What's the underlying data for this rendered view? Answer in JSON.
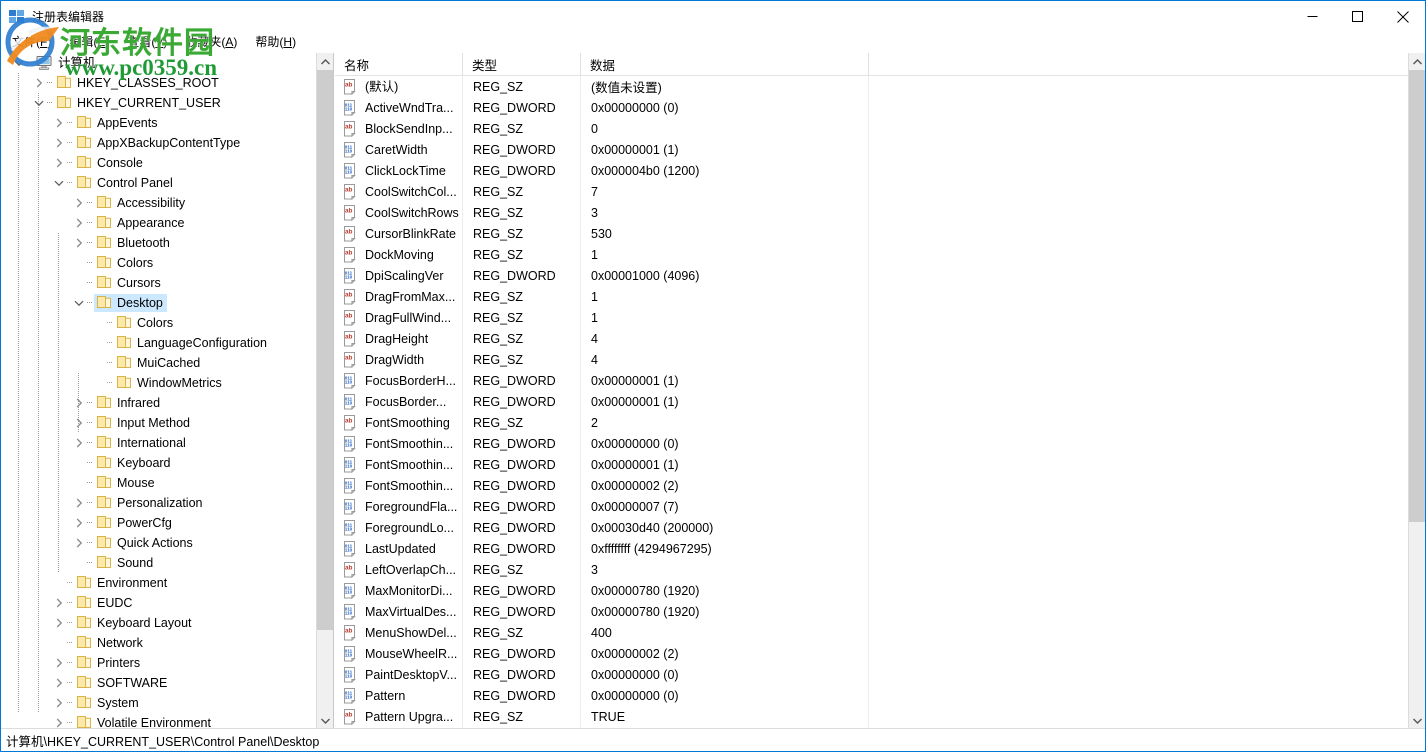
{
  "window": {
    "title": "注册表编辑器",
    "icon": "registry-editor-icon",
    "accent_color": "#0078d7",
    "buttons": {
      "minimize": "最小化",
      "maximize": "最大化",
      "close": "关闭"
    }
  },
  "menubar": [
    {
      "name": "file",
      "label": "文件(F)",
      "text": "文件(",
      "accel": "F",
      "tail": ")"
    },
    {
      "name": "edit",
      "label": "编辑(E)",
      "text": "编辑(",
      "accel": "E",
      "tail": ")"
    },
    {
      "name": "view",
      "label": "查看(V)",
      "text": "查看(",
      "accel": "V",
      "tail": ")"
    },
    {
      "name": "favorites",
      "label": "收藏夹(A)",
      "text": "收藏夹(",
      "accel": "A",
      "tail": ")"
    },
    {
      "name": "help",
      "label": "帮助(H)",
      "text": "帮助(",
      "accel": "H",
      "tail": ")"
    }
  ],
  "tree": {
    "selected": "Desktop",
    "items": [
      {
        "label": "计算机",
        "depth": 0,
        "icon": "computer-icon",
        "twist": "expanded"
      },
      {
        "label": "HKEY_CLASSES_ROOT",
        "depth": 1,
        "icon": "folder-icon",
        "twist": "collapsed"
      },
      {
        "label": "HKEY_CURRENT_USER",
        "depth": 1,
        "icon": "folder-icon",
        "twist": "expanded"
      },
      {
        "label": "AppEvents",
        "depth": 2,
        "icon": "folder-icon",
        "twist": "collapsed"
      },
      {
        "label": "AppXBackupContentType",
        "depth": 2,
        "icon": "folder-icon",
        "twist": "collapsed"
      },
      {
        "label": "Console",
        "depth": 2,
        "icon": "folder-icon",
        "twist": "collapsed"
      },
      {
        "label": "Control Panel",
        "depth": 2,
        "icon": "folder-icon",
        "twist": "expanded"
      },
      {
        "label": "Accessibility",
        "depth": 3,
        "icon": "folder-icon",
        "twist": "collapsed"
      },
      {
        "label": "Appearance",
        "depth": 3,
        "icon": "folder-icon",
        "twist": "collapsed"
      },
      {
        "label": "Bluetooth",
        "depth": 3,
        "icon": "folder-icon",
        "twist": "collapsed"
      },
      {
        "label": "Colors",
        "depth": 3,
        "icon": "folder-icon",
        "twist": "none"
      },
      {
        "label": "Cursors",
        "depth": 3,
        "icon": "folder-icon",
        "twist": "none"
      },
      {
        "label": "Desktop",
        "depth": 3,
        "icon": "folder-icon",
        "twist": "expanded",
        "selected": true
      },
      {
        "label": "Colors",
        "depth": 4,
        "icon": "folder-icon",
        "twist": "none"
      },
      {
        "label": "LanguageConfiguration",
        "depth": 4,
        "icon": "folder-icon",
        "twist": "none"
      },
      {
        "label": "MuiCached",
        "depth": 4,
        "icon": "folder-icon",
        "twist": "none"
      },
      {
        "label": "WindowMetrics",
        "depth": 4,
        "icon": "folder-icon",
        "twist": "none"
      },
      {
        "label": "Infrared",
        "depth": 3,
        "icon": "folder-icon",
        "twist": "collapsed"
      },
      {
        "label": "Input Method",
        "depth": 3,
        "icon": "folder-icon",
        "twist": "collapsed"
      },
      {
        "label": "International",
        "depth": 3,
        "icon": "folder-icon",
        "twist": "collapsed"
      },
      {
        "label": "Keyboard",
        "depth": 3,
        "icon": "folder-icon",
        "twist": "none"
      },
      {
        "label": "Mouse",
        "depth": 3,
        "icon": "folder-icon",
        "twist": "none"
      },
      {
        "label": "Personalization",
        "depth": 3,
        "icon": "folder-icon",
        "twist": "collapsed"
      },
      {
        "label": "PowerCfg",
        "depth": 3,
        "icon": "folder-icon",
        "twist": "collapsed"
      },
      {
        "label": "Quick Actions",
        "depth": 3,
        "icon": "folder-icon",
        "twist": "collapsed"
      },
      {
        "label": "Sound",
        "depth": 3,
        "icon": "folder-icon",
        "twist": "none"
      },
      {
        "label": "Environment",
        "depth": 2,
        "icon": "folder-icon",
        "twist": "none"
      },
      {
        "label": "EUDC",
        "depth": 2,
        "icon": "folder-icon",
        "twist": "collapsed"
      },
      {
        "label": "Keyboard Layout",
        "depth": 2,
        "icon": "folder-icon",
        "twist": "collapsed"
      },
      {
        "label": "Network",
        "depth": 2,
        "icon": "folder-icon",
        "twist": "none"
      },
      {
        "label": "Printers",
        "depth": 2,
        "icon": "folder-icon",
        "twist": "collapsed"
      },
      {
        "label": "SOFTWARE",
        "depth": 2,
        "icon": "folder-icon",
        "twist": "collapsed"
      },
      {
        "label": "System",
        "depth": 2,
        "icon": "folder-icon",
        "twist": "collapsed"
      },
      {
        "label": "Volatile Environment",
        "depth": 2,
        "icon": "folder-icon",
        "twist": "collapsed"
      }
    ]
  },
  "list": {
    "columns": [
      {
        "name": "name",
        "label": "名称"
      },
      {
        "name": "type",
        "label": "类型"
      },
      {
        "name": "data",
        "label": "数据"
      }
    ],
    "rows": [
      {
        "name": "(默认)",
        "type": "REG_SZ",
        "data": "(数值未设置)",
        "icon": "string-value-icon"
      },
      {
        "name": "ActiveWndTra...",
        "type": "REG_DWORD",
        "data": "0x00000000 (0)",
        "icon": "dword-value-icon"
      },
      {
        "name": "BlockSendInp...",
        "type": "REG_SZ",
        "data": "0",
        "icon": "string-value-icon"
      },
      {
        "name": "CaretWidth",
        "type": "REG_DWORD",
        "data": "0x00000001 (1)",
        "icon": "dword-value-icon"
      },
      {
        "name": "ClickLockTime",
        "type": "REG_DWORD",
        "data": "0x000004b0 (1200)",
        "icon": "dword-value-icon"
      },
      {
        "name": "CoolSwitchCol...",
        "type": "REG_SZ",
        "data": "7",
        "icon": "string-value-icon"
      },
      {
        "name": "CoolSwitchRows",
        "type": "REG_SZ",
        "data": "3",
        "icon": "string-value-icon"
      },
      {
        "name": "CursorBlinkRate",
        "type": "REG_SZ",
        "data": "530",
        "icon": "string-value-icon"
      },
      {
        "name": "DockMoving",
        "type": "REG_SZ",
        "data": "1",
        "icon": "string-value-icon"
      },
      {
        "name": "DpiScalingVer",
        "type": "REG_DWORD",
        "data": "0x00001000 (4096)",
        "icon": "dword-value-icon"
      },
      {
        "name": "DragFromMax...",
        "type": "REG_SZ",
        "data": "1",
        "icon": "string-value-icon"
      },
      {
        "name": "DragFullWind...",
        "type": "REG_SZ",
        "data": "1",
        "icon": "string-value-icon"
      },
      {
        "name": "DragHeight",
        "type": "REG_SZ",
        "data": "4",
        "icon": "string-value-icon"
      },
      {
        "name": "DragWidth",
        "type": "REG_SZ",
        "data": "4",
        "icon": "string-value-icon"
      },
      {
        "name": "FocusBorderH...",
        "type": "REG_DWORD",
        "data": "0x00000001 (1)",
        "icon": "dword-value-icon"
      },
      {
        "name": "FocusBorder...",
        "type": "REG_DWORD",
        "data": "0x00000001 (1)",
        "icon": "dword-value-icon"
      },
      {
        "name": "FontSmoothing",
        "type": "REG_SZ",
        "data": "2",
        "icon": "string-value-icon"
      },
      {
        "name": "FontSmoothin...",
        "type": "REG_DWORD",
        "data": "0x00000000 (0)",
        "icon": "dword-value-icon"
      },
      {
        "name": "FontSmoothin...",
        "type": "REG_DWORD",
        "data": "0x00000001 (1)",
        "icon": "dword-value-icon"
      },
      {
        "name": "FontSmoothin...",
        "type": "REG_DWORD",
        "data": "0x00000002 (2)",
        "icon": "dword-value-icon"
      },
      {
        "name": "ForegroundFla...",
        "type": "REG_DWORD",
        "data": "0x00000007 (7)",
        "icon": "dword-value-icon"
      },
      {
        "name": "ForegroundLo...",
        "type": "REG_DWORD",
        "data": "0x00030d40 (200000)",
        "icon": "dword-value-icon"
      },
      {
        "name": "LastUpdated",
        "type": "REG_DWORD",
        "data": "0xffffffff (4294967295)",
        "icon": "dword-value-icon"
      },
      {
        "name": "LeftOverlapCh...",
        "type": "REG_SZ",
        "data": "3",
        "icon": "string-value-icon"
      },
      {
        "name": "MaxMonitorDi...",
        "type": "REG_DWORD",
        "data": "0x00000780 (1920)",
        "icon": "dword-value-icon"
      },
      {
        "name": "MaxVirtualDes...",
        "type": "REG_DWORD",
        "data": "0x00000780 (1920)",
        "icon": "dword-value-icon"
      },
      {
        "name": "MenuShowDel...",
        "type": "REG_SZ",
        "data": "400",
        "icon": "string-value-icon"
      },
      {
        "name": "MouseWheelR...",
        "type": "REG_DWORD",
        "data": "0x00000002 (2)",
        "icon": "dword-value-icon"
      },
      {
        "name": "PaintDesktopV...",
        "type": "REG_DWORD",
        "data": "0x00000000 (0)",
        "icon": "dword-value-icon"
      },
      {
        "name": "Pattern",
        "type": "REG_DWORD",
        "data": "0x00000000 (0)",
        "icon": "dword-value-icon"
      },
      {
        "name": "Pattern Upgra...",
        "type": "REG_SZ",
        "data": "TRUE",
        "icon": "string-value-icon"
      }
    ]
  },
  "statusbar": {
    "path": "计算机\\HKEY_CURRENT_USER\\Control Panel\\Desktop"
  },
  "watermark": {
    "site_name": "河东软件园",
    "url": "www.pc0359.cn",
    "name_color": "#3aaa35",
    "url_color": "#1f9b36"
  }
}
